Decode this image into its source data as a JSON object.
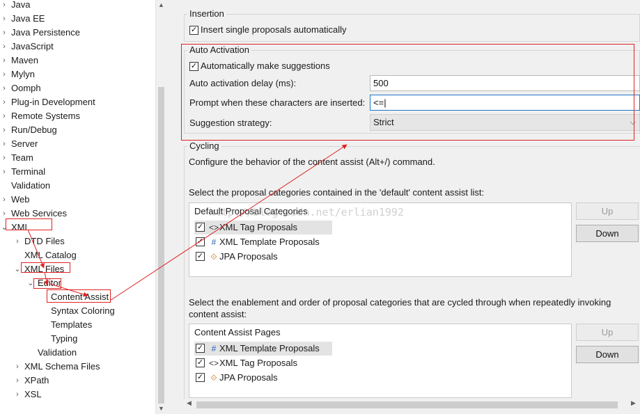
{
  "tree": {
    "items": [
      {
        "label": "Java",
        "twisty": "›"
      },
      {
        "label": "Java EE",
        "twisty": "›"
      },
      {
        "label": "Java Persistence",
        "twisty": "›"
      },
      {
        "label": "JavaScript",
        "twisty": "›"
      },
      {
        "label": "Maven",
        "twisty": "›"
      },
      {
        "label": "Mylyn",
        "twisty": "›"
      },
      {
        "label": "Oomph",
        "twisty": "›"
      },
      {
        "label": "Plug-in Development",
        "twisty": "›"
      },
      {
        "label": "Remote Systems",
        "twisty": "›"
      },
      {
        "label": "Run/Debug",
        "twisty": "›"
      },
      {
        "label": "Server",
        "twisty": "›"
      },
      {
        "label": "Team",
        "twisty": "›"
      },
      {
        "label": "Terminal",
        "twisty": "›"
      },
      {
        "label": "Validation",
        "twisty": ""
      },
      {
        "label": "Web",
        "twisty": "›"
      },
      {
        "label": "Web Services",
        "twisty": "›"
      },
      {
        "label": "XML",
        "twisty": "⌄"
      },
      {
        "label": "DTD Files",
        "twisty": "›"
      },
      {
        "label": "XML Catalog",
        "twisty": ""
      },
      {
        "label": "XML Files",
        "twisty": "⌄"
      },
      {
        "label": "Editor",
        "twisty": "⌄"
      },
      {
        "label": "Content Assist",
        "twisty": ""
      },
      {
        "label": "Syntax Coloring",
        "twisty": ""
      },
      {
        "label": "Templates",
        "twisty": ""
      },
      {
        "label": "Typing",
        "twisty": ""
      },
      {
        "label": "Validation",
        "twisty": ""
      },
      {
        "label": "XML Schema Files",
        "twisty": "›"
      },
      {
        "label": "XPath",
        "twisty": "›"
      },
      {
        "label": "XSL",
        "twisty": "›"
      }
    ]
  },
  "insertion": {
    "title": "Insertion",
    "insert_single_label": "Insert single proposals automatically",
    "insert_single_checked": true
  },
  "auto_activation": {
    "title": "Auto Activation",
    "auto_suggest_label": "Automatically make suggestions",
    "auto_suggest_checked": true,
    "delay_label": "Auto activation delay (ms):",
    "delay_value": "500",
    "chars_label": "Prompt when these characters are inserted:",
    "chars_value": "<=",
    "strategy_label": "Suggestion strategy:",
    "strategy_value": "Strict"
  },
  "cycling": {
    "title": "Cycling",
    "description": "Configure the behavior of the content assist (Alt+/) command."
  },
  "default_list": {
    "caption": "Select the proposal categories contained in the 'default' content assist list:",
    "header": "Default Proposal Categories",
    "items": [
      {
        "label": "XML Tag Proposals",
        "icon": "<>",
        "checked": true
      },
      {
        "label": "XML Template Proposals",
        "icon": "#",
        "checked": true
      },
      {
        "label": "JPA Proposals",
        "icon": "⟐",
        "checked": true
      }
    ],
    "up_label": "Up",
    "down_label": "Down"
  },
  "pages_list": {
    "caption_line1": "Select the enablement and order of proposal categories that are cycled through when repeatedly invoking",
    "caption_line2": "content assist:",
    "header": "Content Assist Pages",
    "items": [
      {
        "label": "XML Template Proposals",
        "icon": "#",
        "checked": true
      },
      {
        "label": "XML Tag Proposals",
        "icon": "<>",
        "checked": true
      },
      {
        "label": "JPA Proposals",
        "icon": "⟐",
        "checked": true
      }
    ],
    "up_label": "Up",
    "down_label": "Down"
  },
  "watermark": "http://blog.csdn.net/erlian1992",
  "colors": {
    "annotation": "#e02020",
    "focus": "#1f74c9",
    "selection": "#e3e3e3"
  }
}
